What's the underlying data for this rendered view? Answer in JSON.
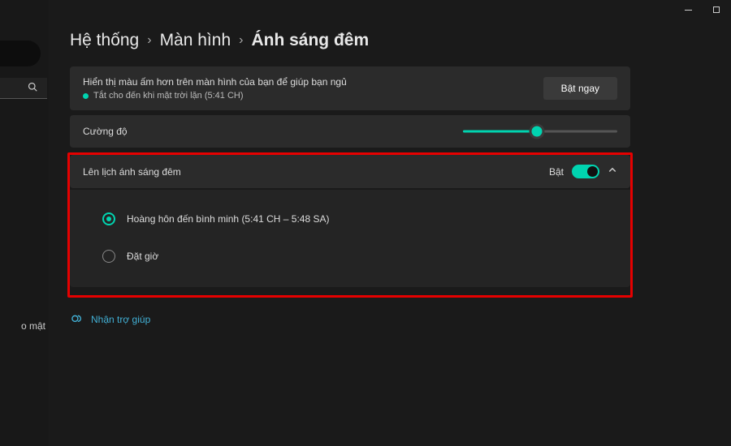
{
  "window_controls": {
    "minimize": "minimize",
    "restore": "restore"
  },
  "sidebar": {
    "search_placeholder": "",
    "truncated_label": "o mật"
  },
  "breadcrumb": {
    "lvl1": "Hệ thống",
    "lvl2": "Màn hình",
    "current": "Ánh sáng đêm",
    "separator": "›"
  },
  "header_card": {
    "description": "Hiển thị màu ấm hơn trên màn hình của bạn để giúp bạn ngủ",
    "status_text": "Tắt cho đến khi mặt trời lặn (5:41 CH)",
    "turn_on_button": "Bật ngay"
  },
  "strength": {
    "label": "Cường độ",
    "value_percent": 48
  },
  "schedule": {
    "header_label": "Lên lịch ánh sáng đêm",
    "toggle_label": "Bật",
    "toggle_on": true,
    "options": [
      {
        "id": "sunset",
        "label": "Hoàng hôn đến bình minh (5:41 CH – 5:48 SA)",
        "selected": true
      },
      {
        "id": "sethours",
        "label": "Đặt giờ",
        "selected": false
      }
    ]
  },
  "help_link": "Nhận trợ giúp",
  "colors": {
    "accent": "#00d4b0",
    "highlight_border": "#e60000",
    "link": "#42b0d5"
  }
}
